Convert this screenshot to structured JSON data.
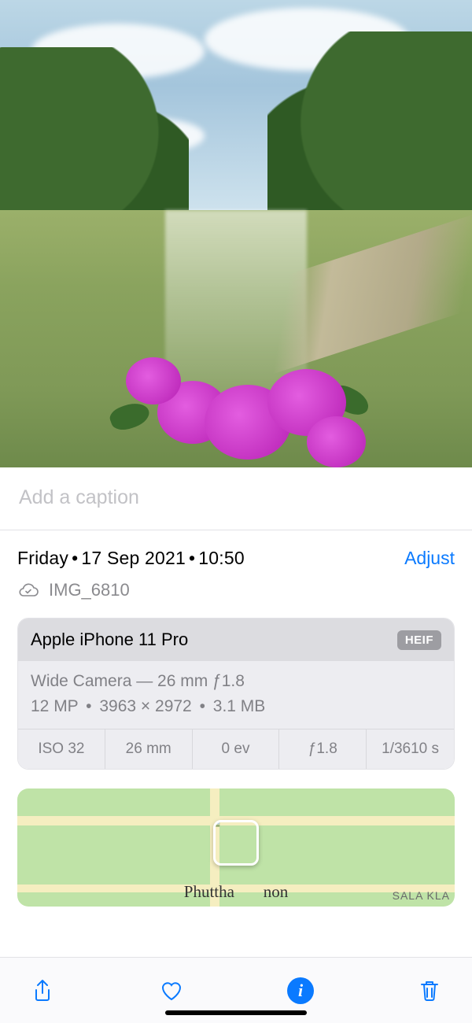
{
  "caption": {
    "placeholder": "Add a caption"
  },
  "meta": {
    "day": "Friday",
    "date": "17 Sep 2021",
    "time": "10:50",
    "adjust_label": "Adjust",
    "filename": "IMG_6810"
  },
  "camera": {
    "device": "Apple iPhone 11 Pro",
    "format_badge": "HEIF",
    "lens_line": "Wide Camera — 26 mm ƒ1.8",
    "megapixels": "12 MP",
    "dimensions": "3963 × 2972",
    "filesize": "3.1 MB",
    "specs": {
      "iso": "ISO 32",
      "focal": "26 mm",
      "ev": "0 ev",
      "aperture": "ƒ1.8",
      "shutter": "1/3610 s"
    }
  },
  "map": {
    "place_primary": "Phuttha",
    "place_primary_suffix": "non",
    "place_secondary": "SALA KLA"
  },
  "toolbar": {
    "share": "Share",
    "favorite": "Favorite",
    "info": "Info",
    "delete": "Delete"
  }
}
